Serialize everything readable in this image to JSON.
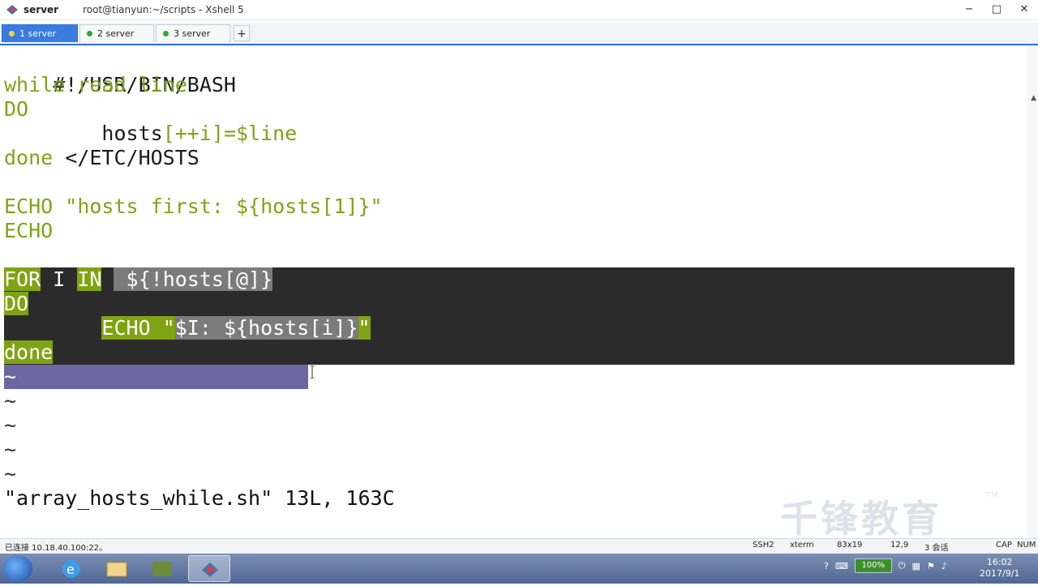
{
  "window": {
    "app_name": "server",
    "title": "root@tianyun:~/scripts - Xshell 5",
    "min_label": "−",
    "max_label": "□",
    "close_label": "✕"
  },
  "tabs": [
    {
      "label": "1 server",
      "active": true
    },
    {
      "label": "2 server",
      "active": false
    },
    {
      "label": "3 server",
      "active": false
    }
  ],
  "tab_add_label": "+",
  "terminal": {
    "lines": {
      "l1": "#!/USR/BIN/BASH",
      "l2_kw1": "while",
      "l2_kw2": "read",
      "l2_rest": " line",
      "l3": "DO",
      "l4_indent": "        ",
      "l4_a": "hosts",
      "l4_b": "[++i]",
      "l4_c": "=$line",
      "l5_kw": "done",
      "l5_rest": " </ETC/HOSTS",
      "l7_kw": "ECHO",
      "l7_rest": " \"hosts first: ${hosts[1]}\"",
      "l8": "ECHO",
      "l10_for": "FOR",
      "l10_i": " I ",
      "l10_in": "IN",
      "l10_rest": " ${!hosts[@]}",
      "l11": "DO",
      "l12_indent": "        ",
      "l12_echo": "ECHO",
      "l12_q": " \"",
      "l12_str": "$I: ${hosts[i]}",
      "l12_end": "\"",
      "l13": "done",
      "tilde": "~"
    },
    "status_message": "\"array_hosts_while.sh\" 13L, 163C"
  },
  "watermark": {
    "text": "千锋教育",
    "tm": "TM"
  },
  "statusbar": {
    "connection": "已连接 10.18.40.100:22。",
    "protocol": "SSH2",
    "term": "xterm",
    "size": "83x19",
    "cursor_pos": "12,9",
    "sessions": "3 会话",
    "caps": "CAP",
    "num": "NUM"
  },
  "taskbar": {
    "battery": "100%",
    "time": "16:02",
    "date": "2017/9/1"
  },
  "colors": {
    "keyword": "#80a31a",
    "selection_bg": "#2b2b2b",
    "cursor_line": "#6a67a3",
    "tab_active": "#3a7be0"
  }
}
